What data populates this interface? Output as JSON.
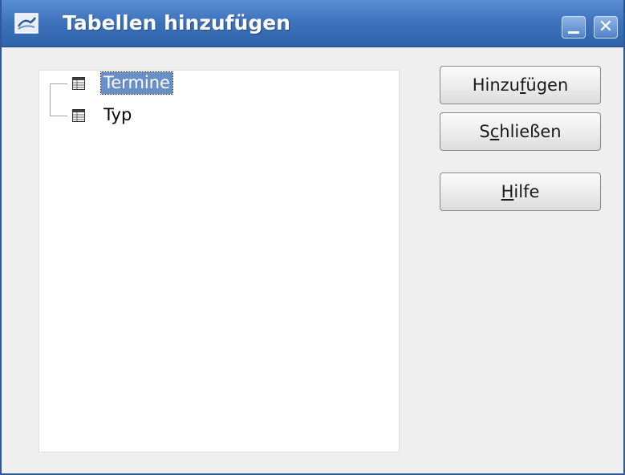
{
  "window": {
    "title": "Tabellen hinzufügen",
    "title_bar_color": "#3f74bd"
  },
  "tables": [
    {
      "name": "Termine",
      "selected": true,
      "icon": "table-icon"
    },
    {
      "name": "Typ",
      "selected": false,
      "icon": "table-icon"
    }
  ],
  "buttons": {
    "add": {
      "pre": "Hinzu",
      "mnemonic": "f",
      "post": "ügen"
    },
    "close": {
      "pre": "S",
      "mnemonic": "c",
      "post": "hließen"
    },
    "help": {
      "pre": "",
      "mnemonic": "H",
      "post": "ilfe"
    }
  },
  "colors": {
    "selection": "#6990c6"
  }
}
